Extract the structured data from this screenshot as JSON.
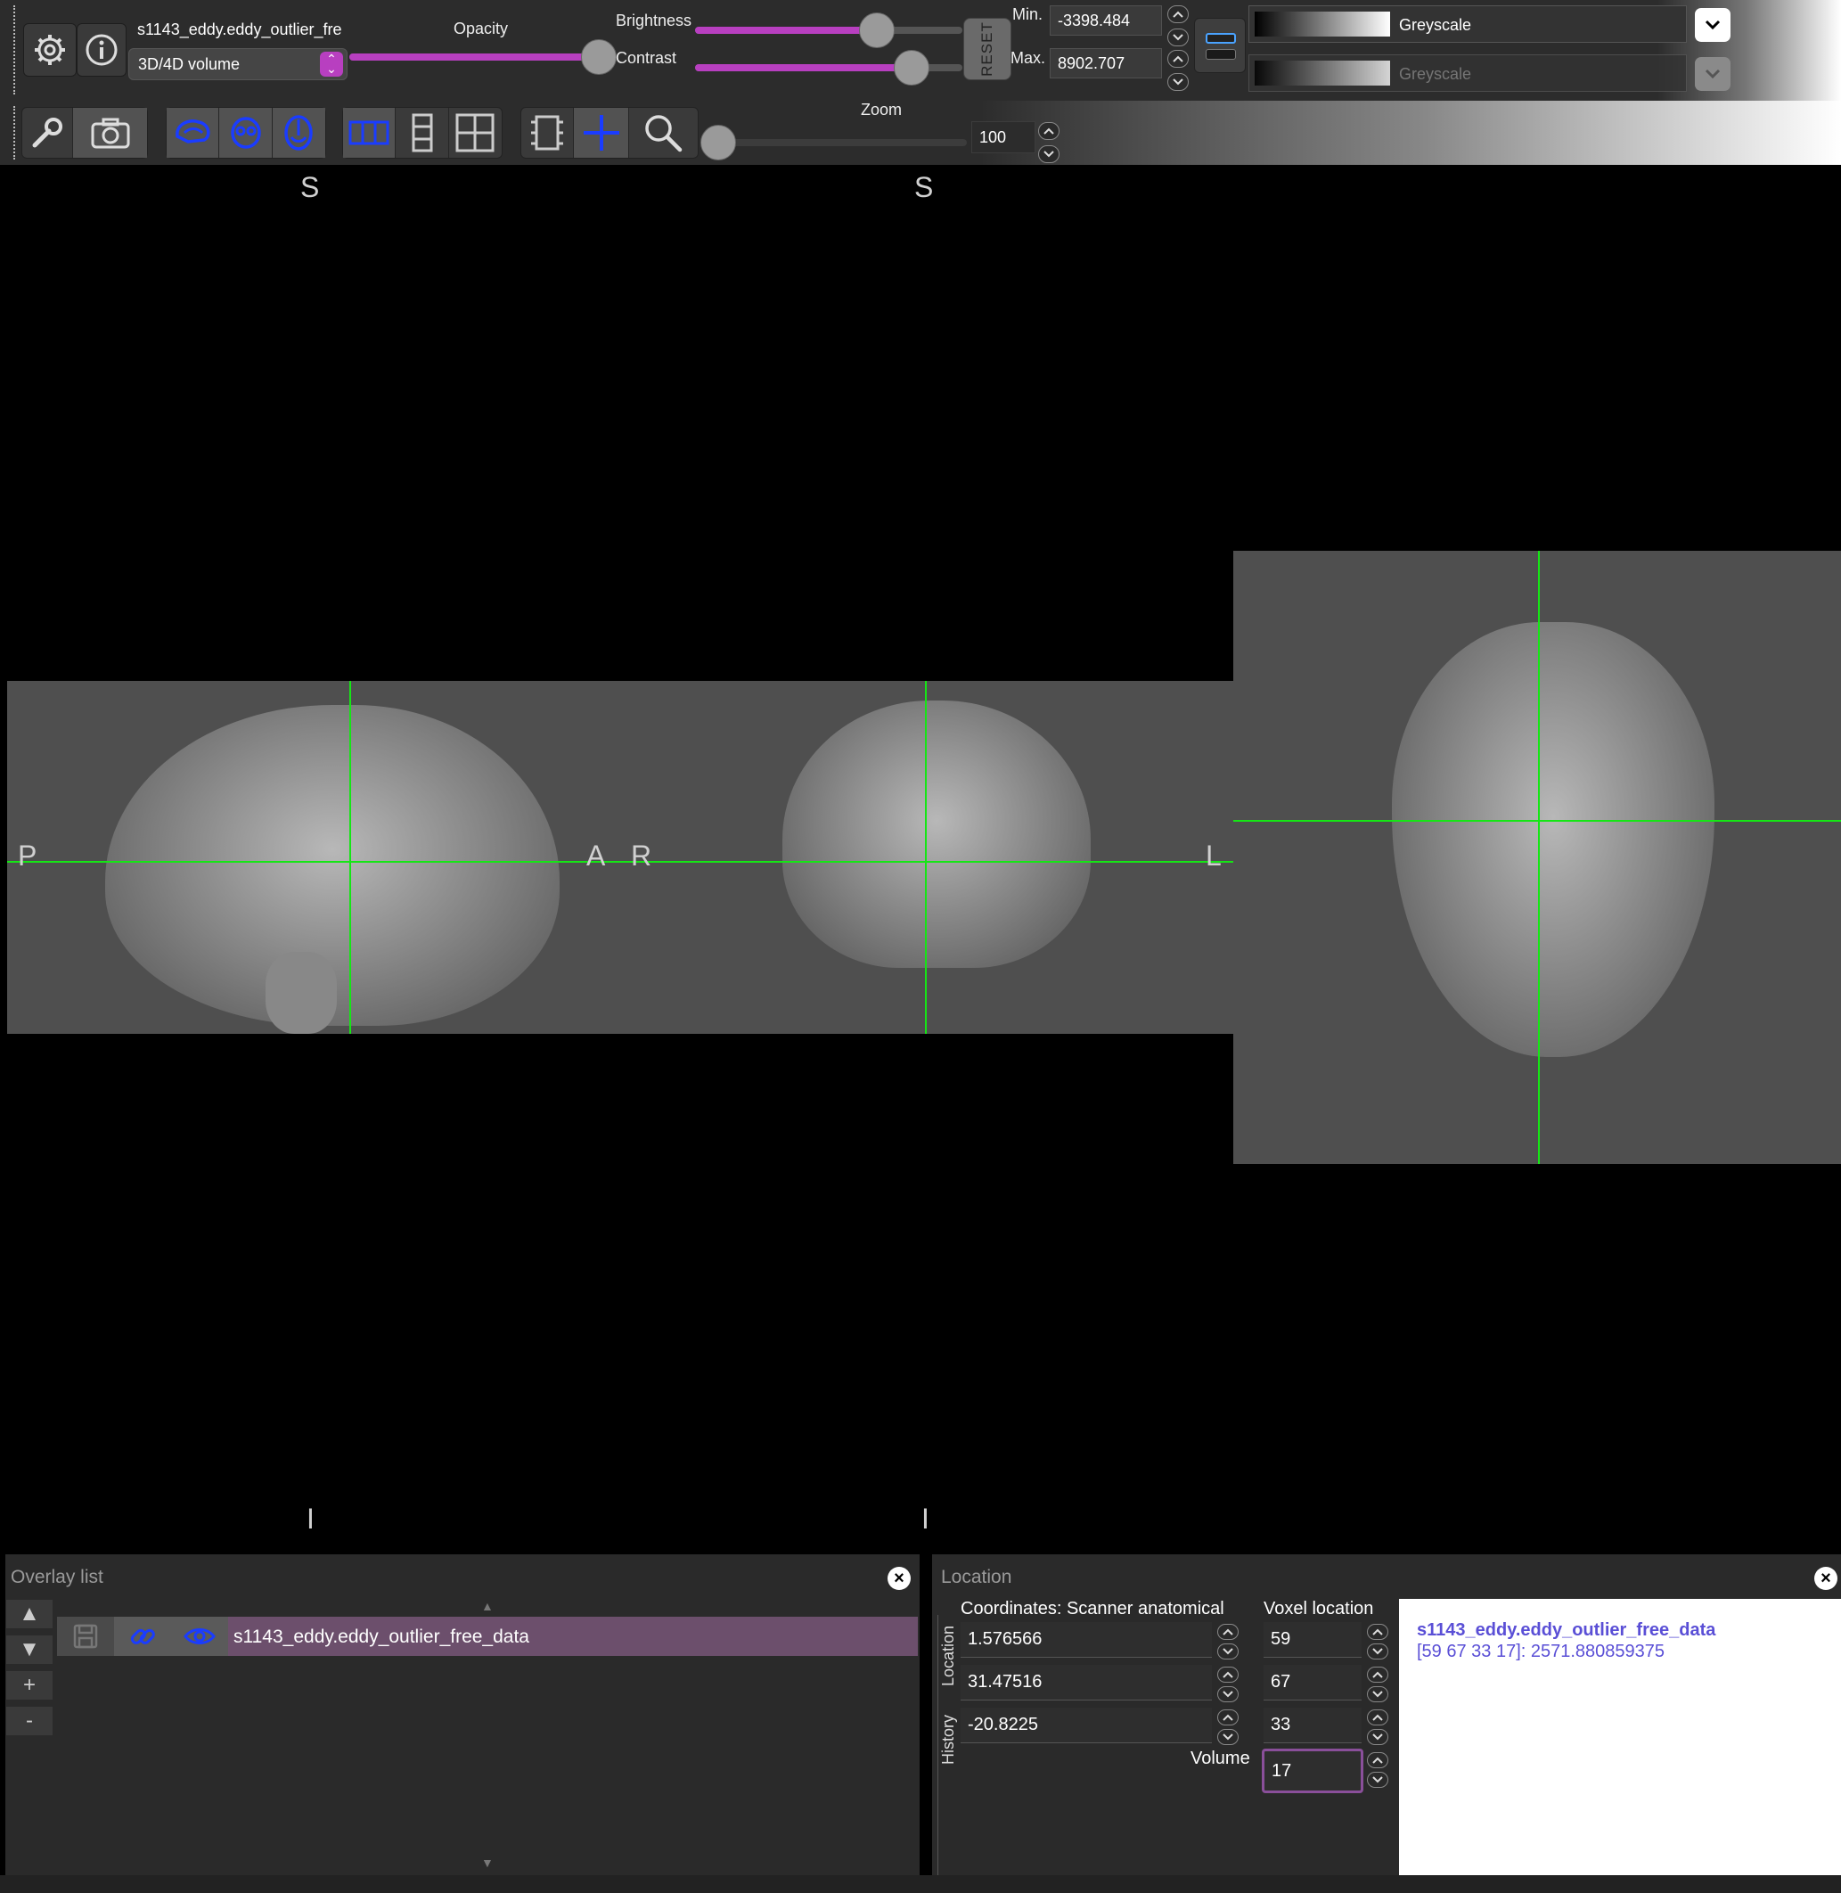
{
  "toolbar": {
    "overlay_name": "s1143_eddy.eddy_outlier_fre",
    "overlay_type": "3D/4D volume",
    "opacity_label": "Opacity",
    "opacity_value": 1.0,
    "brightness_label": "Brightness",
    "brightness_value": 0.68,
    "contrast_label": "Contrast",
    "contrast_value": 0.81,
    "reset_label": "RESET",
    "min_label": "Min.",
    "min_value": "-3398.484",
    "max_label": "Max.",
    "max_value": "8902.707",
    "cmap_primary": "Greyscale",
    "cmap_secondary": "Greyscale"
  },
  "tools": {
    "zoom_label": "Zoom",
    "zoom_value": "100"
  },
  "viewer": {
    "sagittal": {
      "top": "S",
      "bottom": "I",
      "left": "P",
      "right": "A"
    },
    "coronal": {
      "top": "S",
      "bottom": "I",
      "left": "R",
      "right": "L"
    }
  },
  "overlay_list": {
    "title": "Overlay list",
    "items": [
      {
        "name": "s1143_eddy.eddy_outlier_free_data"
      }
    ],
    "up_label": "▲",
    "down_label": "▼",
    "add_label": "+",
    "remove_label": "-",
    "scroll_up": "▲",
    "scroll_down": "▼"
  },
  "location": {
    "title": "Location",
    "tab_location": "Location",
    "tab_history": "History",
    "coords_header": "Coordinates: Scanner anatomical",
    "voxel_header": "Voxel location",
    "coords": [
      "1.576566",
      "31.47516",
      "-20.8225"
    ],
    "voxels": [
      "59",
      "67",
      "33"
    ],
    "volume_label": "Volume",
    "volume_value": "17",
    "info_name": "s1143_eddy.eddy_outlier_free_data",
    "info_value": "[59 67 33 17]: 2571.880859375"
  },
  "colors": {
    "accent": "#b83fc0",
    "crosshair": "#15e615",
    "info_text": "#5a4fd6"
  }
}
